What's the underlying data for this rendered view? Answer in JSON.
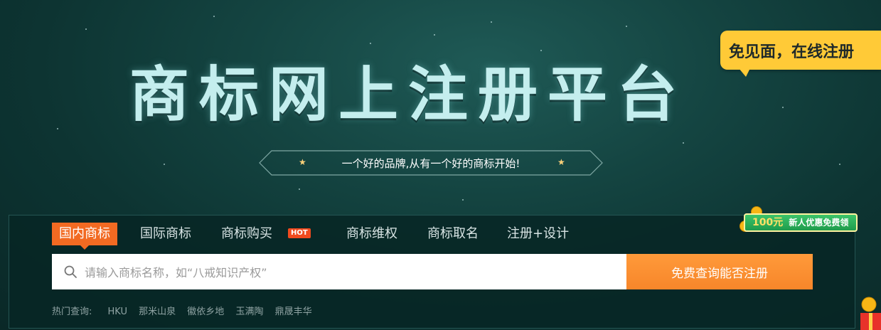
{
  "hero": {
    "title": "商标网上注册平台",
    "slogan": "一个好的品牌,从有一个好的商标开始!",
    "slogan_star": "★"
  },
  "promo": {
    "bubble_text": "免见面，在线注册",
    "coupon_amount": "100元",
    "coupon_text": "新人优惠免费领"
  },
  "tabs": [
    {
      "label": "国内商标",
      "active": true
    },
    {
      "label": "国际商标",
      "active": false
    },
    {
      "label": "商标购买",
      "active": false,
      "badge": "HOT"
    },
    {
      "label": "商标维权",
      "active": false
    },
    {
      "label": "商标取名",
      "active": false
    },
    {
      "label": "注册+设计",
      "active": false
    }
  ],
  "search": {
    "placeholder": "请输入商标名称，如“八戒知识产权”",
    "button_label": "免费查询能否注册"
  },
  "hot_search": {
    "label": "热门查询:",
    "items": [
      "HKU",
      "那米山泉",
      "徽依乡地",
      "玉满陶",
      "鼎晟丰华"
    ]
  },
  "colors": {
    "accent_orange": "#f26a22",
    "button_orange": "#f7862a",
    "bubble_yellow": "#ffca37",
    "background_teal": "#144441"
  }
}
